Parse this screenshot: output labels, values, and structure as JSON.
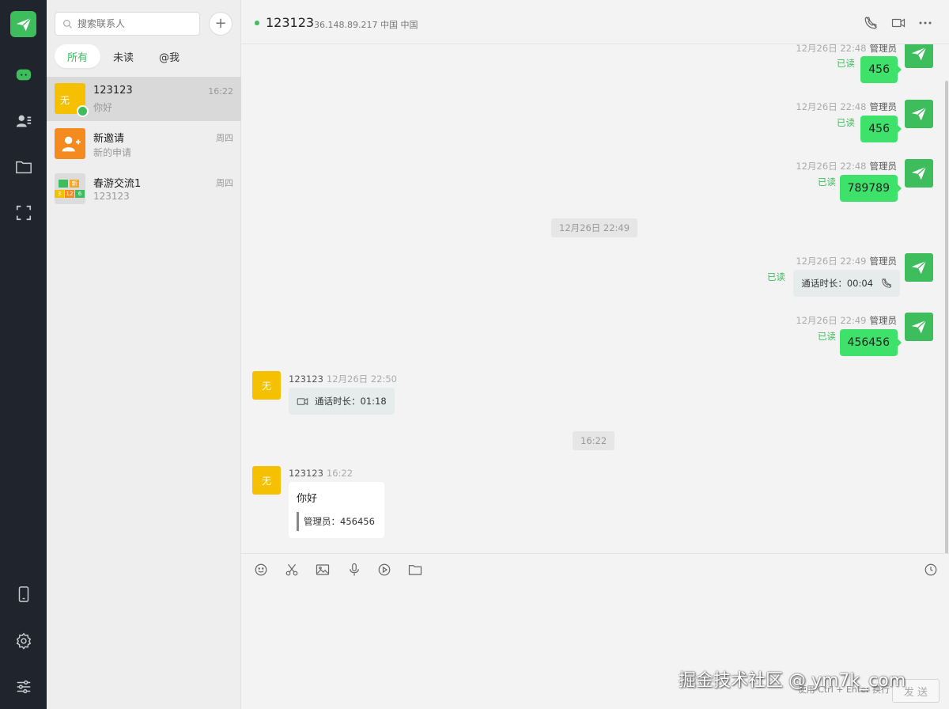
{
  "sidebar": {
    "icons": [
      "paper-plane-logo-icon",
      "chat-icon",
      "contacts-icon",
      "folder-icon",
      "scan-icon",
      "phone-icon",
      "gear-icon",
      "sliders-icon"
    ]
  },
  "session_list": {
    "search_placeholder": "搜索联系人",
    "add_label": "+",
    "tabs": [
      {
        "label": "所有",
        "active": true
      },
      {
        "label": "未读",
        "active": false
      },
      {
        "label": "@我",
        "active": false
      }
    ],
    "items": [
      {
        "avatar_text": "无",
        "name": "123123",
        "preview": "你好",
        "time": "16:22",
        "active": true,
        "online": true
      },
      {
        "avatar_text": "",
        "name": "新邀请",
        "preview": "新的申请",
        "time": "周四",
        "active": false
      },
      {
        "avatar_text": "",
        "name": "春游交流1",
        "preview": "123123",
        "time": "周四",
        "active": false
      }
    ],
    "group_avatar_cells": [
      "",
      "新",
      "3",
      "12",
      "6"
    ]
  },
  "chat": {
    "title": "123123",
    "subtitle": "36.148.89.217 中国 中国",
    "messages": [
      {
        "kind": "self-text",
        "time": "12月26日 22:48",
        "sender": "管理员",
        "status": "已读",
        "text": "456"
      },
      {
        "kind": "self-text",
        "time": "12月26日 22:48",
        "sender": "管理员",
        "status": "已读",
        "text": "456"
      },
      {
        "kind": "self-text",
        "time": "12月26日 22:48",
        "sender": "管理员",
        "status": "已读",
        "text": "789789"
      },
      {
        "kind": "time-divider",
        "text": "12月26日 22:49"
      },
      {
        "kind": "self-call",
        "time": "12月26日 22:49",
        "sender": "管理员",
        "status": "已读",
        "text": "通话时长：00:04"
      },
      {
        "kind": "self-text",
        "time": "12月26日 22:49",
        "sender": "管理员",
        "status": "已读",
        "text": "456456"
      },
      {
        "kind": "peer-call",
        "sender": "123123",
        "time": "12月26日 22:50",
        "avatar_text": "无",
        "text": "通话时长：01:18"
      },
      {
        "kind": "time-divider",
        "text": "16:22"
      },
      {
        "kind": "peer-text",
        "sender": "123123",
        "time": "16:22",
        "avatar_text": "无",
        "text": "你好",
        "quote": "管理员：456456"
      }
    ]
  },
  "composer": {
    "tools": [
      "emoji-icon",
      "scissors-icon",
      "image-icon",
      "microphone-icon",
      "play-icon",
      "folder-icon",
      "history-icon"
    ],
    "hint": "使用 Ctrl + Enter 换行",
    "send_label": "发 送"
  },
  "watermark": "掘金技术社区 @ ym7k_com",
  "colors": {
    "accent": "#3ebd5d",
    "self_bubble": "#3ee16a",
    "peer_avatar": "#f5c000",
    "invite_avatar": "#f58a1f",
    "rail_bg": "#20252d"
  }
}
